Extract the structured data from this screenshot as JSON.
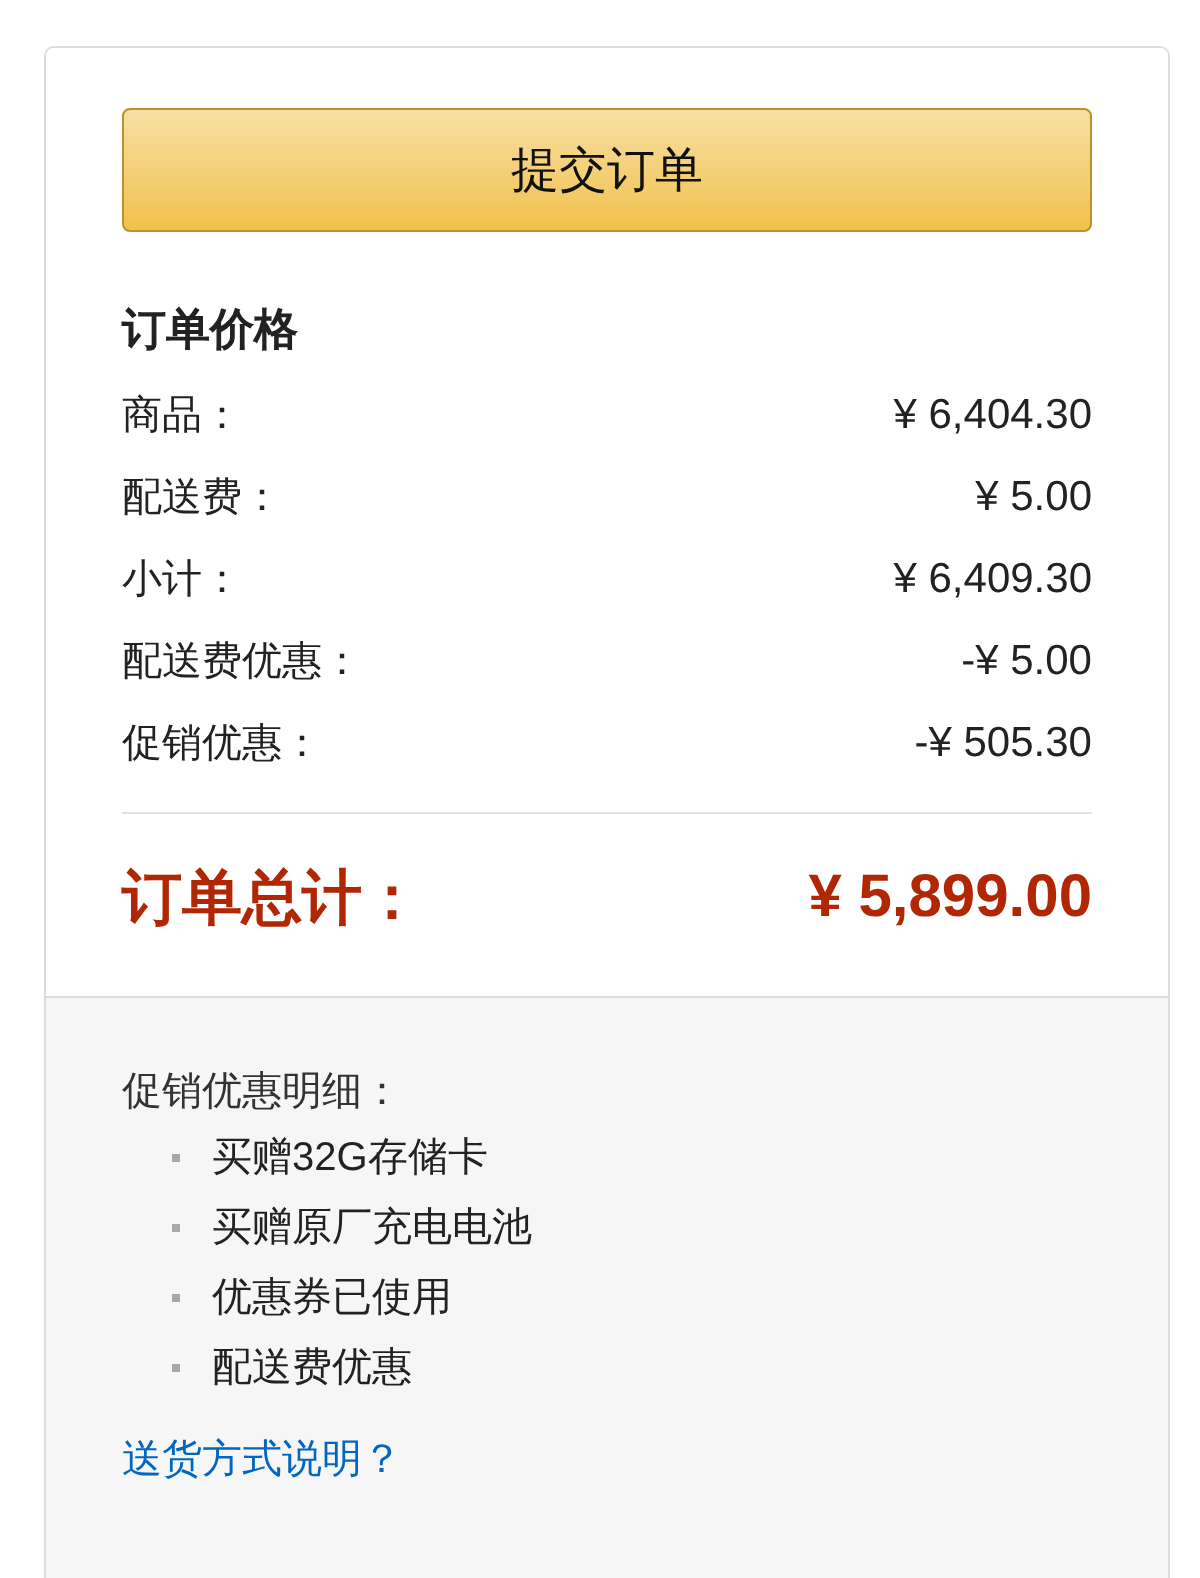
{
  "submit_button": {
    "label": "提交订单"
  },
  "summary": {
    "title": "订单价格",
    "rows": [
      {
        "label": "商品：",
        "value": "¥ 6,404.30"
      },
      {
        "label": "配送费：",
        "value": "¥ 5.00"
      },
      {
        "label": "小计：",
        "value": "¥ 6,409.30"
      },
      {
        "label": "配送费优惠：",
        "value": "-¥ 5.00"
      },
      {
        "label": "促销优惠：",
        "value": "-¥ 505.30"
      }
    ],
    "total": {
      "label": "订单总计：",
      "value": "¥ 5,899.00"
    }
  },
  "promotions": {
    "title": "促销优惠明细：",
    "items": [
      "买赠32G存储卡",
      "买赠原厂充电电池",
      "优惠券已使用",
      "配送费优惠"
    ]
  },
  "shipping_link": {
    "label": "送货方式说明？"
  }
}
